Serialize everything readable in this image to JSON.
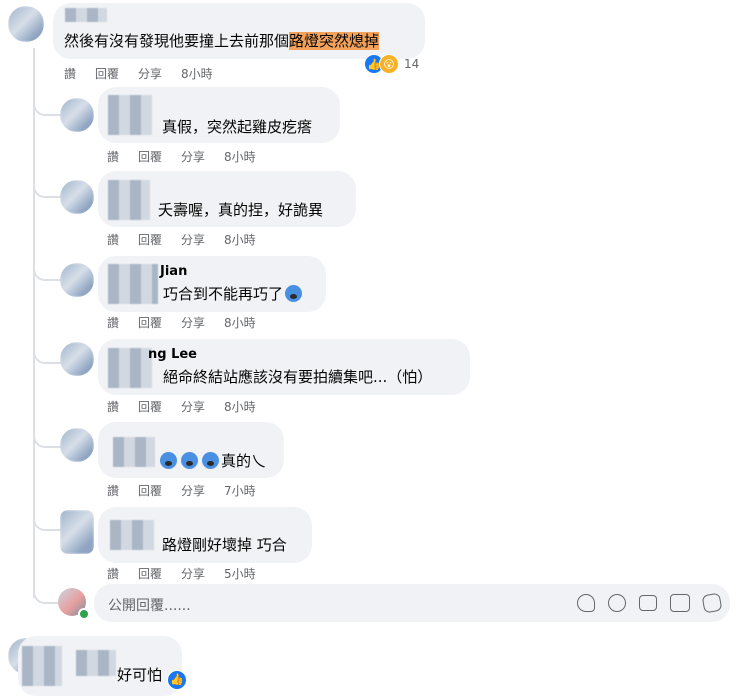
{
  "actions": {
    "like": "讚",
    "reply": "回覆",
    "share": "分享"
  },
  "top_comment": {
    "text_before": "然後有沒有發現他要撞上去前那個",
    "text_highlight": "路燈突然熄掉",
    "reaction_count": "14",
    "time": "8小時"
  },
  "replies": [
    {
      "name_visible": "",
      "text": "真假，突然起雞皮疙瘩",
      "time": "8小時"
    },
    {
      "name_visible": "",
      "text": "夭壽喔，真的捏，好詭異",
      "time": "8小時"
    },
    {
      "name_visible": "Jian",
      "text": "巧合到不能再巧了",
      "time": "8小時"
    },
    {
      "name_visible": "ng Lee",
      "text": "絕命終結站應該沒有要拍續集吧...（怕）",
      "time": "8小時"
    },
    {
      "name_visible": "",
      "text": "真的乀",
      "time": "7小時"
    },
    {
      "name_visible": "",
      "text": "路燈剛好壞掉 巧合",
      "time": "5小時"
    }
  ],
  "reply_input": {
    "placeholder": "公開回覆......"
  },
  "bottom_comment": {
    "text": "好可怕"
  },
  "icons": [
    "like-icon",
    "wow-icon",
    "sticker-icon",
    "emoji-icon",
    "camera-icon",
    "gif-icon",
    "avatar-sticker-icon"
  ]
}
